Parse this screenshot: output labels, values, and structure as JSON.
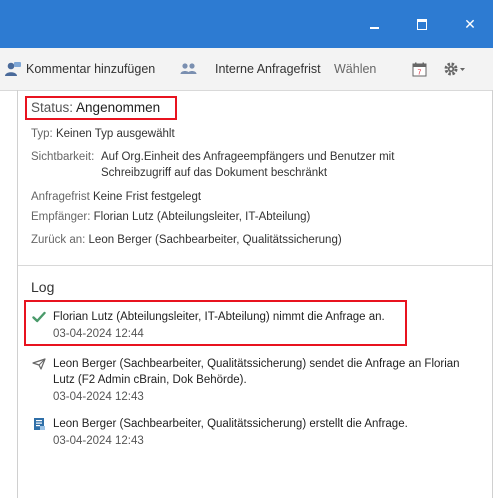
{
  "window": {
    "minimize_icon": "minimize-icon",
    "maximize_icon": "maximize-icon",
    "close_icon": "close-icon",
    "close_glyph": "✕",
    "accent": "#2d7bd2"
  },
  "toolbar": {
    "comment_label": "Kommentar hinzufügen",
    "frist_label": "Interne Anfragefrist",
    "waehlen_label": "Wählen"
  },
  "details": {
    "status_label": "Status:",
    "status_value": "Angenommen",
    "typ_label": "Typ:",
    "typ_value": "Keinen Typ ausgewählt",
    "sichtbarkeit_label": "Sichtbarkeit:",
    "sichtbarkeit_value_1": "Auf Org.Einheit des Anfrageempfängers und Benutzer mit",
    "sichtbarkeit_value_2": "Schreibzugriff auf das Dokument beschränkt",
    "anfragefrist_label": "Anfragefrist",
    "anfragefrist_value": "Keine Frist festgelegt",
    "empfaenger_label": "Empfänger:",
    "empfaenger_value": "Florian Lutz (Abteilungsleiter, IT-Abteilung)",
    "zurueck_label": "Zurück an:",
    "zurueck_value": "Leon Berger (Sachbearbeiter, Qualitätssicherung)"
  },
  "log": {
    "title": "Log",
    "entries": [
      {
        "icon": "checkmark-icon",
        "text": "Florian Lutz (Abteilungsleiter, IT-Abteilung) nimmt die Anfrage an.",
        "timestamp": "03-04-2024 12:44"
      },
      {
        "icon": "send-icon",
        "text": "Leon Berger (Sachbearbeiter, Qualitätssicherung) sendet die Anfrage an Florian Lutz (F2 Admin cBrain, Dok Behörde).",
        "timestamp": "03-04-2024 12:43"
      },
      {
        "icon": "document-icon",
        "text": "Leon Berger (Sachbearbeiter, Qualitätssicherung) erstellt die Anfrage.",
        "timestamp": "03-04-2024 12:43"
      }
    ]
  }
}
